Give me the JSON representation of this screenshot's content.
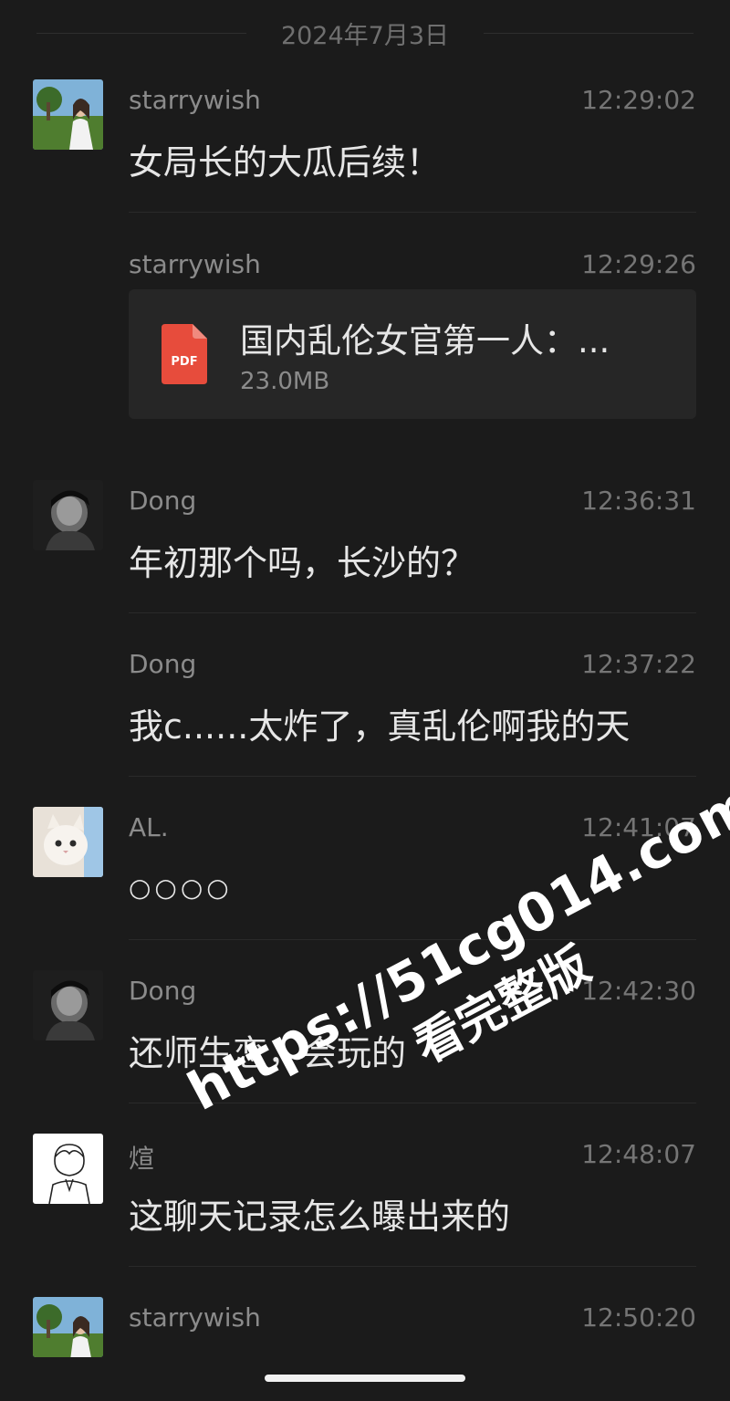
{
  "date_header": "2024年7月3日",
  "messages": [
    {
      "sender": "starrywish",
      "time": "12:29:02",
      "text": "女局长的大瓜后续！",
      "avatar": "avatar-starrywish"
    },
    {
      "sender": "starrywish",
      "time": "12:29:26",
      "file": {
        "name": "国内乱伦女官第一人：...",
        "size": "23.0MB",
        "icon_label": "PDF"
      }
    },
    {
      "sender": "Dong",
      "time": "12:36:31",
      "text": "年初那个吗，长沙的？",
      "avatar": "avatar-dong"
    },
    {
      "sender": "Dong",
      "time": "12:37:22",
      "text": "我c......太炸了，真乱伦啊我的天"
    },
    {
      "sender": "AL.",
      "time": "12:41:07",
      "text": "○○○○",
      "avatar": "avatar-al"
    },
    {
      "sender": "Dong",
      "time": "12:42:30",
      "text": "还师生恋，会玩的",
      "avatar": "avatar-dong"
    },
    {
      "sender": "煊",
      "time": "12:48:07",
      "text": "这聊天记录怎么曝出来的",
      "avatar": "avatar-xuan"
    },
    {
      "sender": "starrywish",
      "time": "12:50:20",
      "avatar": "avatar-starrywish"
    }
  ],
  "watermark": {
    "url": "https://51cg014.com",
    "subtitle": "看完整版"
  },
  "colors": {
    "background": "#1b1b1b",
    "pdf_red": "#e74c3c"
  }
}
